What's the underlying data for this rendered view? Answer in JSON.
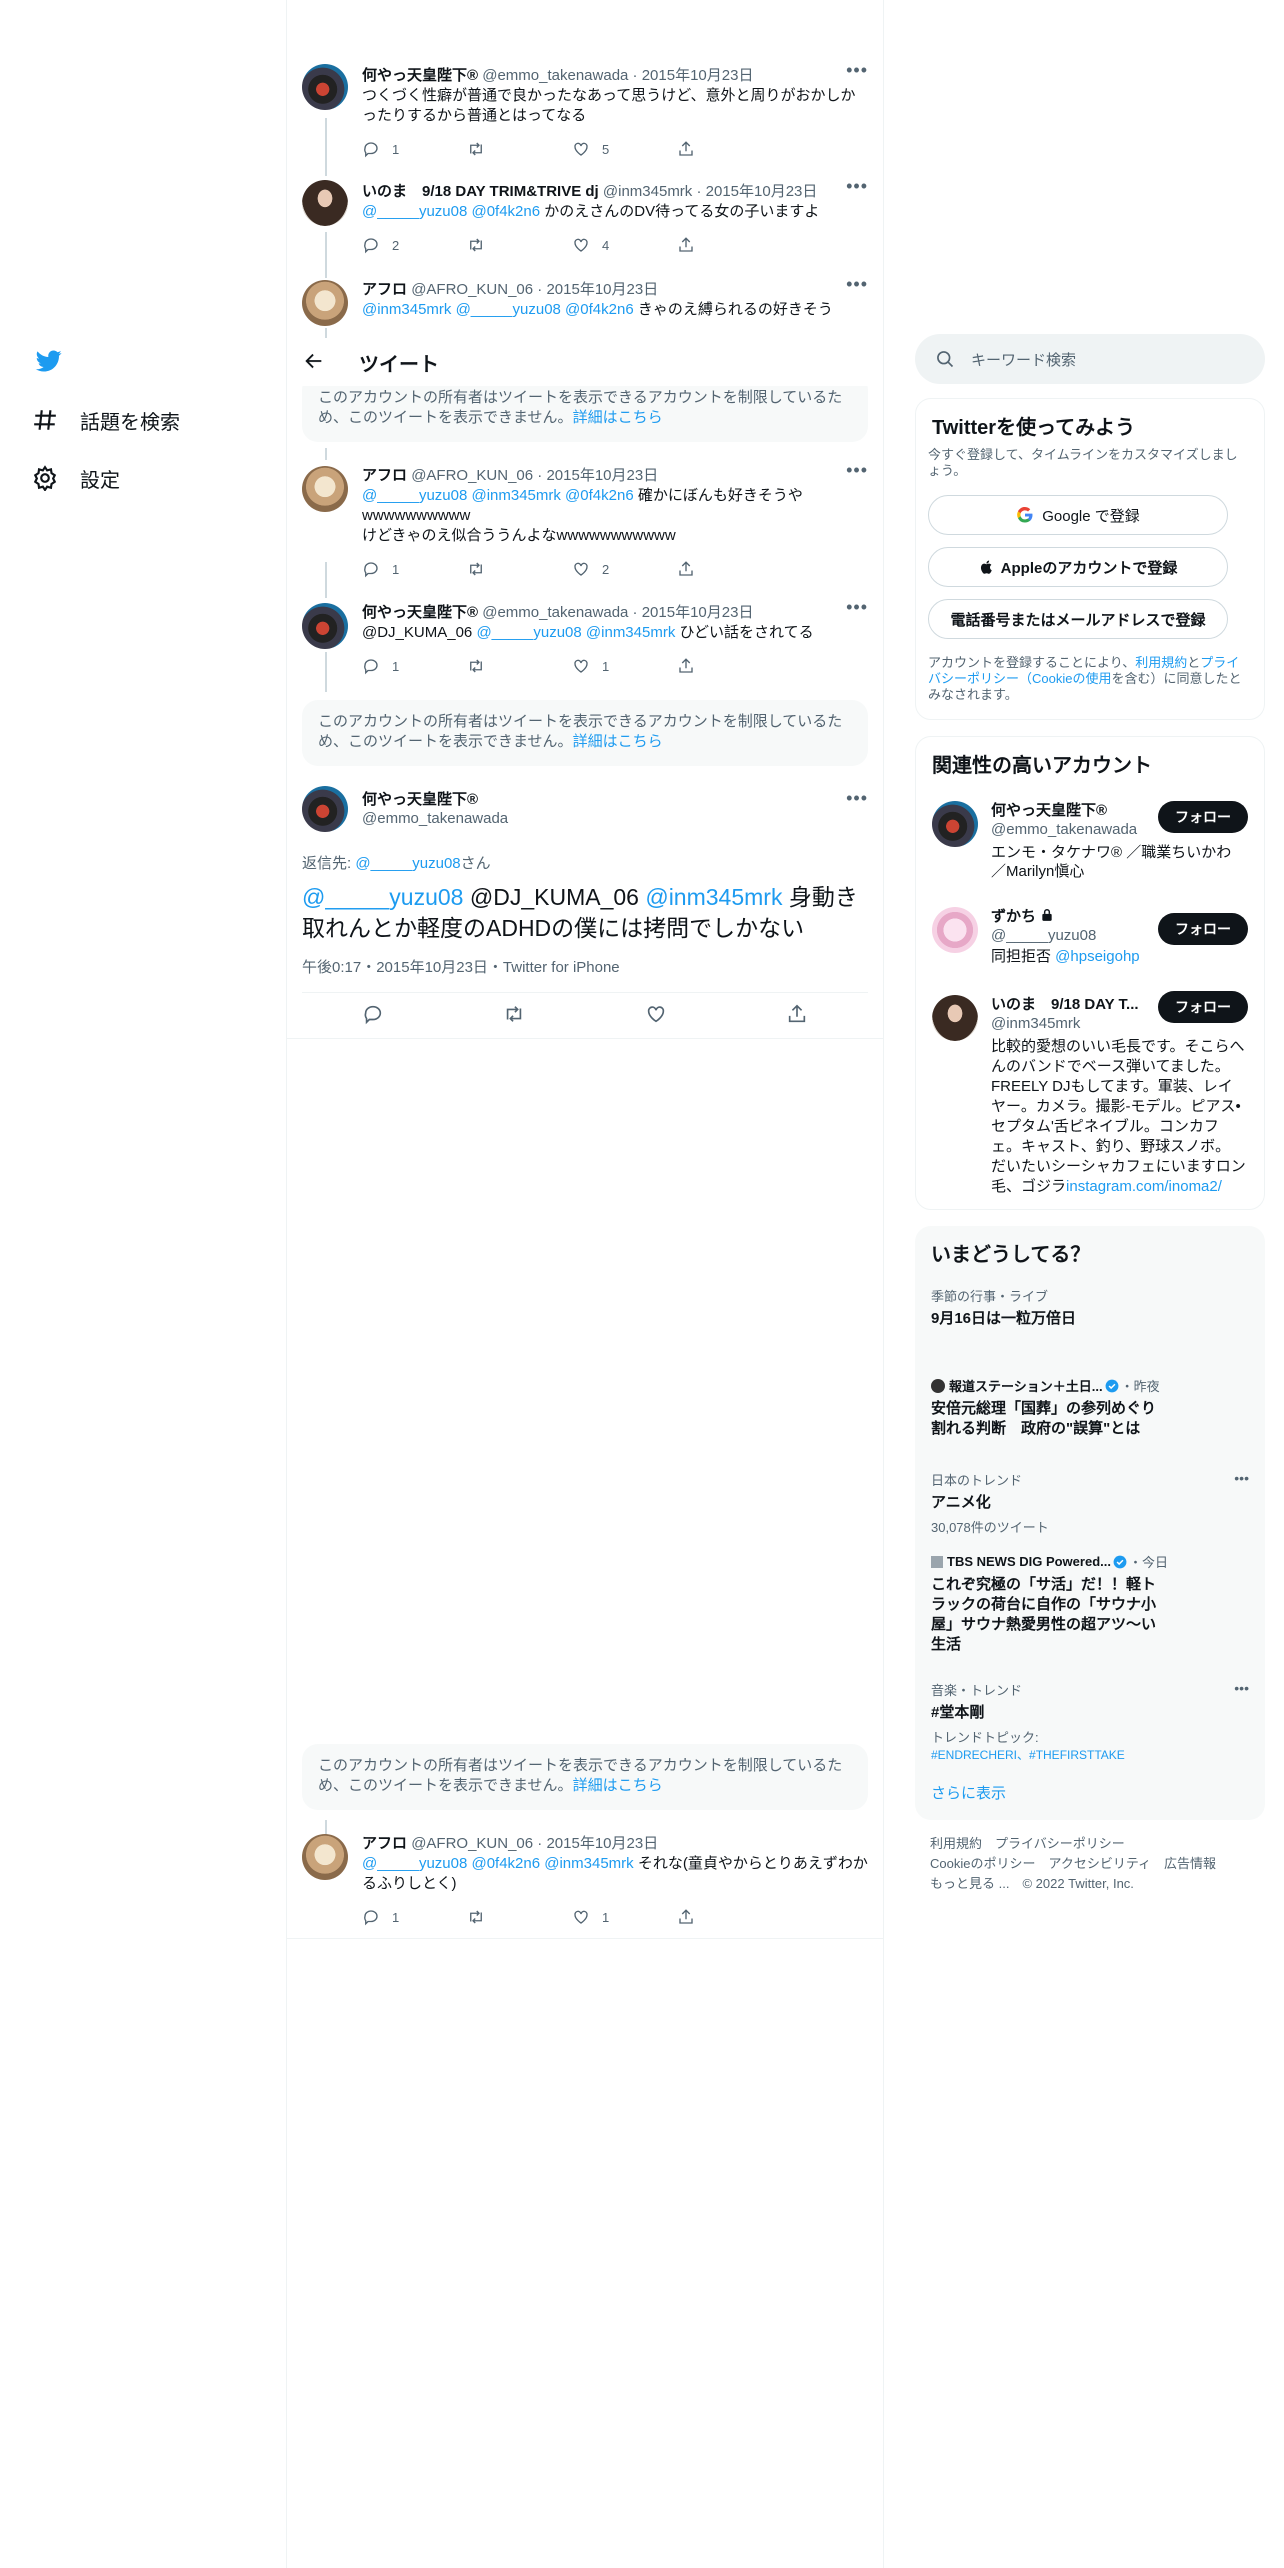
{
  "nav": {
    "explore_label": "話題を検索",
    "settings_label": "設定"
  },
  "header": {
    "title": "ツイート"
  },
  "tweets": [
    {
      "name": "何やっ天皇陛下®",
      "handle": "@emmo_takenawada",
      "date": "2015年10月23日",
      "text_line1": "つくづく性癖が普通で良かったなあって思うけど、意外と周りがおかしか",
      "text_line2": "ったりするから普通とはってなる",
      "replies": "1",
      "retweets": "",
      "likes": "5"
    },
    {
      "name": "いのま　9/18 DAY TRIM&TRIVE dj",
      "handle": "@inm345mrk",
      "date": "2015年10月23日",
      "mentions": "@_____yuzu08 @0f4k2n6",
      "text": " かのえさんのDV待ってる女の子いますよ",
      "replies": "2",
      "retweets": "",
      "likes": "4"
    },
    {
      "name": "アフロ",
      "handle": "@AFRO_KUN_06",
      "date": "2015年10月23日",
      "mentions": "@inm345mrk @_____yuzu08 @0f4k2n6",
      "text": " きゃのえ縛られるの好きそう"
    },
    {
      "name": "アフロ",
      "handle": "@AFRO_KUN_06",
      "date": "2015年10月23日",
      "mentions": "@_____yuzu08 @inm345mrk @0f4k2n6",
      "text": " 確かにぼんも好きそうや",
      "text_line2": "wwwwwwwwww",
      "text_line3": "けどきゃのえ似合ううんよなwwwwwwwwwww",
      "replies": "1",
      "retweets": "",
      "likes": "2"
    },
    {
      "name": "何やっ天皇陛下®",
      "handle": "@emmo_takenawada",
      "date": "2015年10月23日",
      "prefix": "@DJ_KUMA_06 ",
      "mentions": "@_____yuzu08 @inm345mrk",
      "text": " ひどい話をされてる",
      "replies": "1",
      "retweets": "",
      "likes": "1"
    },
    {
      "name": "アフロ",
      "handle": "@AFRO_KUN_06",
      "date": "2015年10月23日",
      "mentions": "@_____yuzu08 @0f4k2n6 @inm345mrk",
      "text": " それな(童貞やからとりあえずわか",
      "text_line2": "るふりしとく)",
      "replies": "1",
      "retweets": "",
      "likes": "1"
    }
  ],
  "restricted_notice": {
    "line1": "このアカウントの所有者はツイートを表示できるアカウントを制限しているた",
    "line2": "め、このツイートを表示できません。",
    "link": "詳細はこちら"
  },
  "main_tweet": {
    "name": "何やっ天皇陛下®",
    "handle": "@emmo_takenawada",
    "reply_to_label": "返信先: ",
    "reply_to_handle": "@_____yuzu08",
    "reply_to_suffix": "さん",
    "mention1": "@_____yuzu08",
    "plain1": " @DJ_KUMA_06 ",
    "mention2": "@inm345mrk",
    "text_a": " 身動き",
    "text_b": "取れんとか軽度のADHDの僕には拷問でしかない",
    "meta": "午後0:17・2015年10月23日・Twitter for iPhone"
  },
  "search": {
    "placeholder": "キーワード検索"
  },
  "signup": {
    "title": "Twitterを使ってみよう",
    "desc_line1": "今すぐ登録して、タイムラインをカスタマイズしまし",
    "desc_line2": "ょう。",
    "google": "Google で登録",
    "apple": "Appleのアカウントで登録",
    "phone": "電話番号またはメールアドレスで登録",
    "terms_a": "アカウントを登録することにより、",
    "terms_tos": "利用規約",
    "terms_b": "と",
    "terms_privacy": "プライ",
    "terms_privacy2": "バシーポリシー",
    "terms_cookie": "（Cookieの使用",
    "terms_c": "を含む）に同意したと",
    "terms_d": "みなされます。"
  },
  "relevant": {
    "title": "関連性の高いアカウント",
    "follow": "フォロー",
    "accounts": [
      {
        "name": "何やっ天皇陛下®",
        "handle": "@emmo_takenawada",
        "bio1": "エンモ・タケナワ® ／職業ちいかわ",
        "bio2": "／Marilyn愼心"
      },
      {
        "name": "ずかち",
        "handle": "@_____yuzu08",
        "bio_a": "同担拒否 ",
        "bio_link": "@hpseigohp"
      },
      {
        "name": "いのま　9/18 DAY T...",
        "handle": "@inm345mrk",
        "bio_lines": [
          "比較的愛想のいい毛長です。そこらへ",
          "んのバンドでベース弾いてました。",
          "FREELY DJもしてます。軍装、レイ",
          "ヤー。カメラ。撮影-モデル。ピアス•",
          "セプタム'舌ピネイブル。コンカフ",
          "ェ。キャスト、釣り、野球スノボ。",
          "だいたいシーシャカフェにいますロン"
        ],
        "bio_last_a": "毛、ゴジラ",
        "bio_last_link": "instagram.com/inoma2/"
      }
    ]
  },
  "trends": {
    "title": "いまどうしてる？",
    "items": [
      {
        "meta": "季節の行事・ライブ",
        "title": "9月16日は一粒万倍日"
      },
      {
        "source": "報道ステーション＋土日...",
        "when": "・昨夜",
        "title1": "安倍元総理「国葬」の参列めぐり",
        "title2": "割れる判断　政府の\"誤算\"とは"
      },
      {
        "meta": "日本のトレンド",
        "title": "アニメ化",
        "count": "30,078件のツイート"
      },
      {
        "source": "TBS NEWS DIG Powered...",
        "when": "・今日",
        "title1": "これぞ究極の「サ活」だ！！軽ト",
        "title2": "ラックの荷台に自作の「サウナ小",
        "title3": "屋」サウナ熱愛男性の超アツ〜い",
        "title4": "生活"
      },
      {
        "meta": "音楽・トレンド",
        "title": "#堂本剛",
        "topic_label": "トレンドトピック:",
        "topics": "#ENDRECHERI、#THEFIRSTTAKE"
      }
    ],
    "show_more": "さらに表示"
  },
  "footer": {
    "line1": "利用規約　プライバシーポリシー",
    "line2": "Cookieのポリシー　アクセシビリティ　広告情報",
    "line3": "もっと見る ...　© 2022 Twitter, Inc."
  },
  "colors": {
    "accent": "#1d9bf0",
    "text": "#0f1419",
    "muted": "#536471"
  }
}
